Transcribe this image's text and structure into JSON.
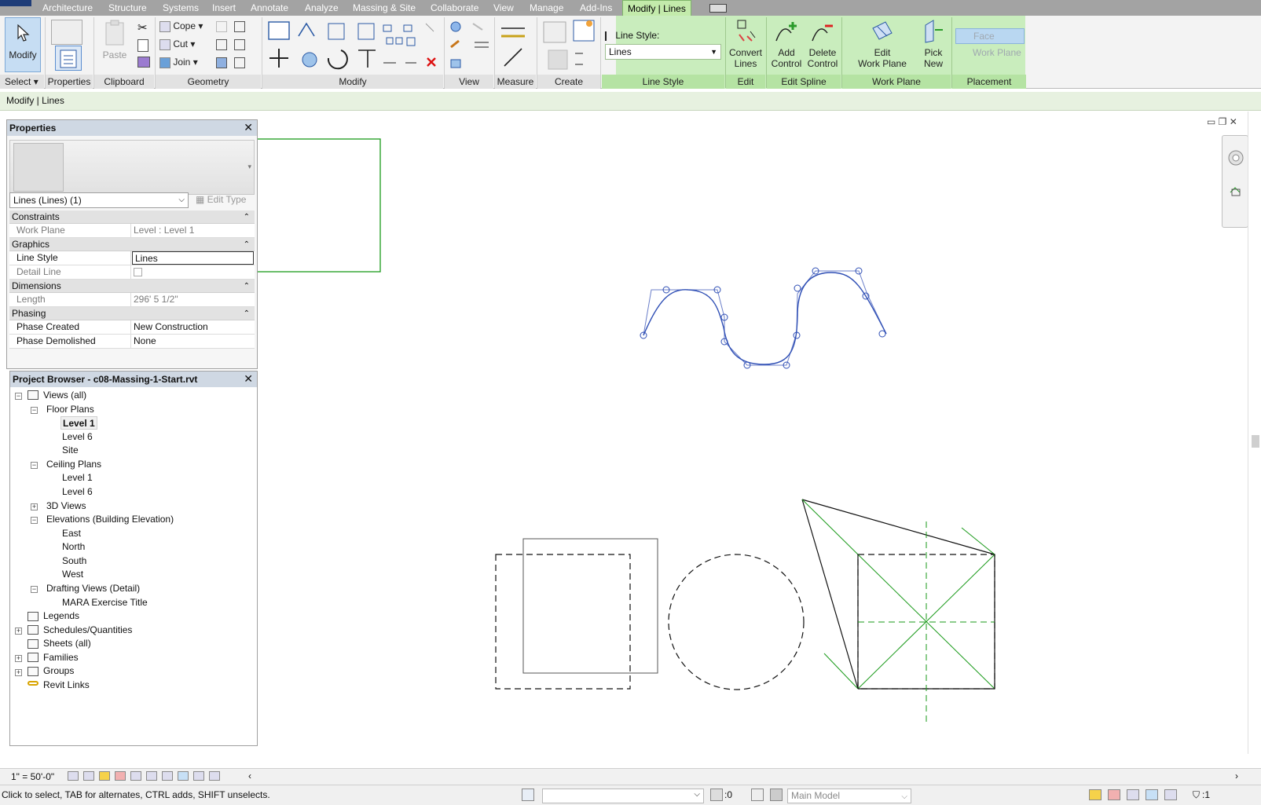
{
  "ribbon": {
    "tabs": [
      "Architecture",
      "Structure",
      "Systems",
      "Insert",
      "Annotate",
      "Analyze",
      "Massing & Site",
      "Collaborate",
      "View",
      "Manage",
      "Add-Ins",
      "Modify | Lines"
    ],
    "modify_label": "Modify",
    "select_label": "Select",
    "properties_label": "Properties",
    "clipboard": {
      "label": "Clipboard",
      "paste": "Paste"
    },
    "geometry": {
      "label": "Geometry",
      "cope": "Cope",
      "cut": "Cut",
      "join": "Join"
    },
    "panels": {
      "modify": "Modify",
      "view": "View",
      "measure": "Measure",
      "create": "Create",
      "line_style": "Line Style",
      "edit": "Edit",
      "edit_spline": "Edit Spline",
      "work_plane": "Work Plane",
      "placement": "Placement"
    },
    "line_style_label": "Line Style:",
    "line_style_value": "Lines",
    "convert_lines": [
      "Convert",
      "Lines"
    ],
    "add_control": [
      "Add",
      "Control"
    ],
    "delete_control": [
      "Delete",
      "Control"
    ],
    "edit_work_plane": [
      "Edit",
      "Work Plane"
    ],
    "pick_new": [
      "Pick",
      "New"
    ],
    "face": "Face",
    "work_plane_btn": "Work Plane"
  },
  "options_bar": {
    "context": "Modify | Lines"
  },
  "properties": {
    "title": "Properties",
    "type_selector": "Lines (Lines) (1)",
    "edit_type": "Edit Type",
    "sections": {
      "constraints": "Constraints",
      "graphics": "Graphics",
      "dimensions": "Dimensions",
      "phasing": "Phasing"
    },
    "work_plane": {
      "k": "Work Plane",
      "v": "Level : Level 1"
    },
    "line_style": {
      "k": "Line Style",
      "v": "Lines"
    },
    "detail_line": {
      "k": "Detail Line"
    },
    "length": {
      "k": "Length",
      "v": "296'  5 1/2\""
    },
    "phase_created": {
      "k": "Phase Created",
      "v": "New Construction"
    },
    "phase_demolished": {
      "k": "Phase Demolished",
      "v": "None"
    }
  },
  "browser": {
    "title": "Project Browser - c08-Massing-1-Start.rvt",
    "items": {
      "views": "Views (all)",
      "floor_plans": "Floor Plans",
      "fp_level1": "Level 1",
      "fp_level6": "Level 6",
      "fp_site": "Site",
      "ceiling_plans": "Ceiling Plans",
      "cp_level1": "Level 1",
      "cp_level6": "Level 6",
      "views3d": "3D Views",
      "elevations": "Elevations (Building Elevation)",
      "east": "East",
      "north": "North",
      "south": "South",
      "west": "West",
      "drafting": "Drafting Views (Detail)",
      "mara": "MARA Exercise Title",
      "legends": "Legends",
      "schedules": "Schedules/Quantities",
      "sheets": "Sheets (all)",
      "families": "Families",
      "groups": "Groups",
      "links": "Revit Links"
    }
  },
  "view_control": {
    "scale": "1\" = 50'-0\""
  },
  "status": {
    "message": "Click to select, TAB for alternates, CTRL adds, SHIFT unselects.",
    "filter_count": ":0",
    "model": "Main Model",
    "selection_count": ":1"
  },
  "colors": {
    "accent_tab": "#c3ebab",
    "spline": "#2f4fb5",
    "green": "#1a9a1a"
  }
}
